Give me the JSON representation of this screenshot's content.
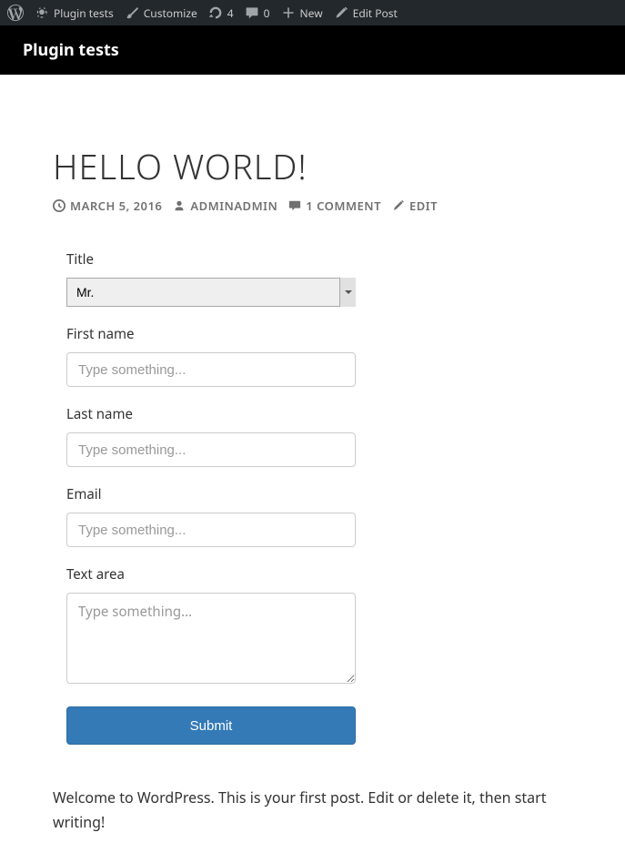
{
  "adminBar": {
    "siteName": "Plugin tests",
    "customize": "Customize",
    "updates": "4",
    "comments": "0",
    "newItem": "New",
    "editPost": "Edit Post"
  },
  "siteHeader": {
    "title": "Plugin tests"
  },
  "post": {
    "title": "HELLO WORLD!",
    "date": "MARCH 5, 2016",
    "author": "ADMINADMIN",
    "comments": "1 COMMENT",
    "edit": "EDIT",
    "body": "Welcome to WordPress. This is your first post. Edit or delete it, then start writing!"
  },
  "form": {
    "titleField": {
      "label": "Title",
      "value": "Mr."
    },
    "firstName": {
      "label": "First name",
      "placeholder": "Type something..."
    },
    "lastName": {
      "label": "Last name",
      "placeholder": "Type something..."
    },
    "email": {
      "label": "Email",
      "placeholder": "Type something..."
    },
    "textarea": {
      "label": "Text area",
      "placeholder": "Type something..."
    },
    "submit": "Submit"
  }
}
